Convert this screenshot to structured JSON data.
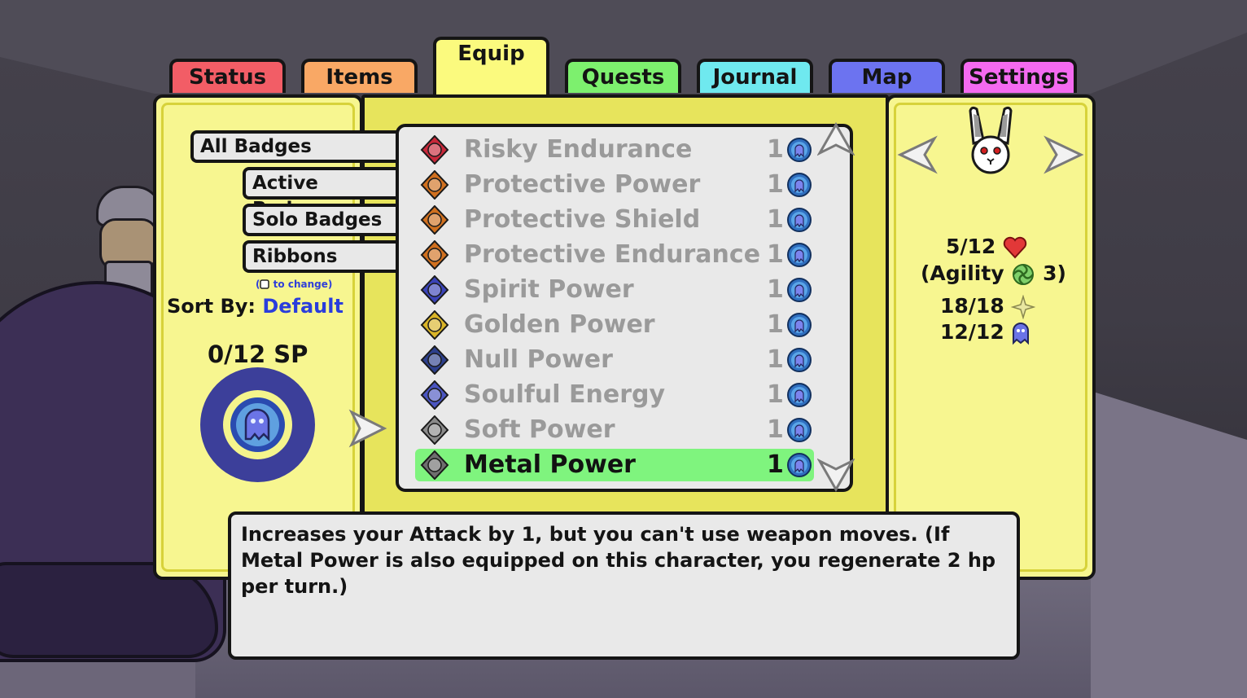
{
  "tabs": [
    {
      "label": "Status",
      "color": "#f25d66"
    },
    {
      "label": "Items",
      "color": "#f9a865"
    },
    {
      "label": "Equip",
      "color": "#fbfa7e"
    },
    {
      "label": "Quests",
      "color": "#7df06e"
    },
    {
      "label": "Journal",
      "color": "#6fe9ef"
    },
    {
      "label": "Map",
      "color": "#6c73f0"
    },
    {
      "label": "Settings",
      "color": "#f46af0"
    }
  ],
  "filters": {
    "all": "All Badges",
    "active": "Active Badges",
    "solo": "Solo Badges",
    "ribbons": "Ribbons"
  },
  "hint": "to change)",
  "hint_open": "(",
  "sort": {
    "label": "Sort By:",
    "value": "Default"
  },
  "sp": "0/12 SP",
  "badges": [
    {
      "name": "Risky Endurance",
      "cost": "1",
      "icon": "risky-endurance-icon",
      "color": "#c8283a"
    },
    {
      "name": "Protective Power",
      "cost": "1",
      "icon": "protective-power-icon",
      "color": "#d0701f"
    },
    {
      "name": "Protective Shield",
      "cost": "1",
      "icon": "protective-shield-icon",
      "color": "#d0701f"
    },
    {
      "name": "Protective Endurance",
      "cost": "1",
      "icon": "protective-endurance-icon",
      "color": "#d0701f"
    },
    {
      "name": "Spirit Power",
      "cost": "1",
      "icon": "spirit-power-icon",
      "color": "#3a43b8"
    },
    {
      "name": "Golden Power",
      "cost": "1",
      "icon": "golden-power-icon",
      "color": "#d9b428"
    },
    {
      "name": "Null Power",
      "cost": "1",
      "icon": "null-power-icon",
      "color": "#2c3f8c"
    },
    {
      "name": "Soulful Energy",
      "cost": "1",
      "icon": "soulful-energy-icon",
      "color": "#4a55c0"
    },
    {
      "name": "Soft Power",
      "cost": "1",
      "icon": "soft-power-icon",
      "color": "#8a8a8a"
    },
    {
      "name": "Metal Power",
      "cost": "1",
      "icon": "metal-power-icon",
      "color": "#6e6e6e"
    }
  ],
  "selected_index": 9,
  "description": "Increases your Attack by 1, but you can't use weapon moves. (If Metal Power is also equipped on this character, you regenerate 2 hp per turn.)",
  "stats": {
    "hp": "5/12",
    "agility_label": "(Agility",
    "agility_value": "3)",
    "tp": "18/18",
    "sp": "12/12"
  }
}
